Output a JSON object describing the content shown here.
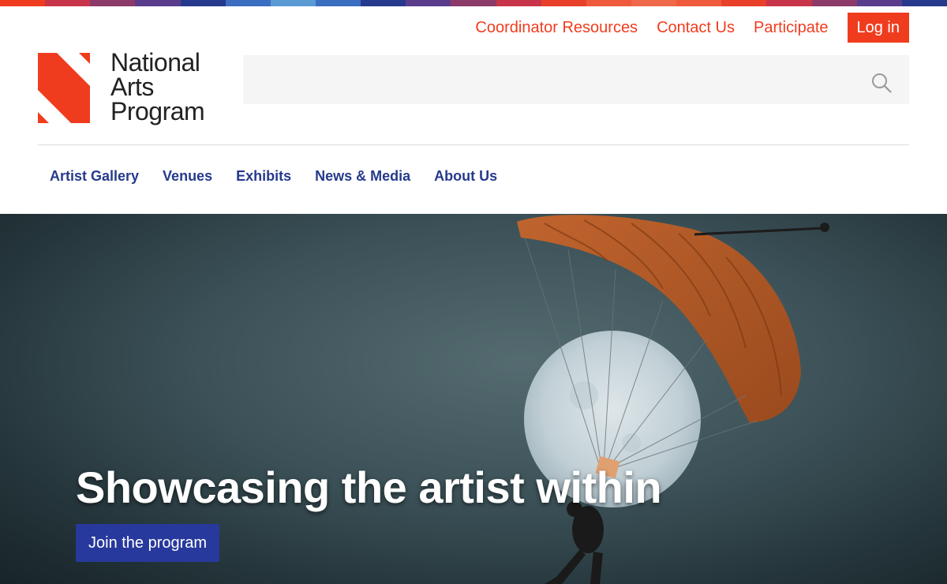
{
  "brand": {
    "name_line1": "National",
    "name_line2": "Arts",
    "name_line3": "Program",
    "accent_color": "#f03c1e",
    "navy_color": "#253a8c"
  },
  "stripe_colors": [
    "#f03c1e",
    "#c8344a",
    "#8c3a6a",
    "#5a3c8c",
    "#253a8c",
    "#3b6ec0",
    "#5a9bd4",
    "#3b6ec0",
    "#253a8c",
    "#5a3c8c",
    "#8c3a6a",
    "#c8344a",
    "#e8402a",
    "#f05a3c",
    "#f0684a",
    "#f05a3c",
    "#e8402a",
    "#c8344a",
    "#8c3a6a",
    "#5a3c8c",
    "#253a8c"
  ],
  "utility_nav": {
    "coordinator": "Coordinator Resources",
    "contact": "Contact Us",
    "participate": "Participate",
    "login": "Log in"
  },
  "search": {
    "placeholder": "",
    "icon": "search-icon"
  },
  "main_nav": [
    {
      "label": "Artist Gallery"
    },
    {
      "label": "Venues"
    },
    {
      "label": "Exhibits"
    },
    {
      "label": "News & Media"
    },
    {
      "label": "About Us"
    }
  ],
  "hero": {
    "title": "Showcasing the artist within",
    "cta": "Join the program",
    "image": "parachutist-moon-artwork"
  }
}
